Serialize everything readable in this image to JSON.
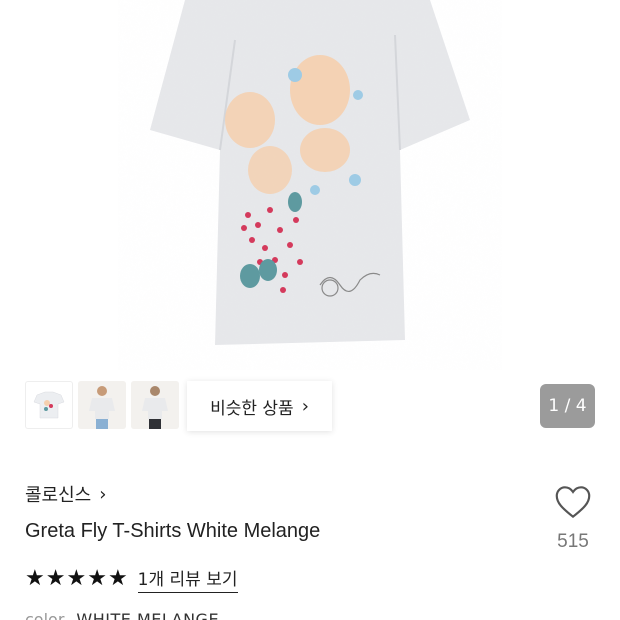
{
  "thumbnails": [
    {
      "name": "thumb-flat-shirt"
    },
    {
      "name": "thumb-model-front"
    },
    {
      "name": "thumb-model-back"
    }
  ],
  "similar": {
    "label": "비슷한 상품",
    "chevron": "›"
  },
  "pager": {
    "text": "1 / 4"
  },
  "brand": {
    "name": "콜로신스",
    "chevron": "›"
  },
  "product": {
    "title": "Greta Fly T-Shirts White Melange"
  },
  "like": {
    "icon": "heart-outline-icon",
    "count": "515"
  },
  "rating": {
    "stars": 5,
    "review_label": "1개 리뷰 보기"
  },
  "color": {
    "label": "color",
    "value": "WHITE MELANGE"
  }
}
